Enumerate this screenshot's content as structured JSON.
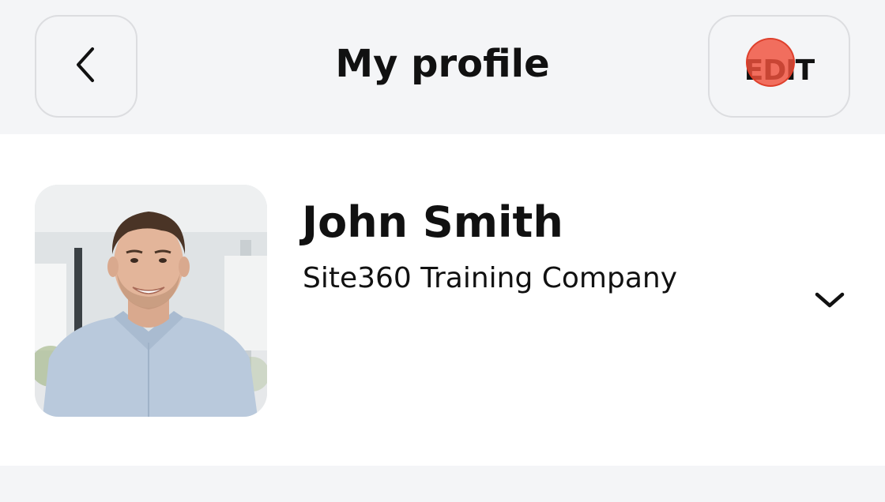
{
  "header": {
    "title": "My profile",
    "back_icon": "chevron-left-icon",
    "edit_label": "EDIT"
  },
  "profile": {
    "name": "John Smith",
    "company": "Site360 Training Company",
    "avatar": "profile-photo",
    "expand_icon": "chevron-down-icon"
  },
  "colors": {
    "background": "#f4f5f7",
    "card": "#ffffff",
    "text": "#111111",
    "tap_indicator": "#f0503c"
  }
}
